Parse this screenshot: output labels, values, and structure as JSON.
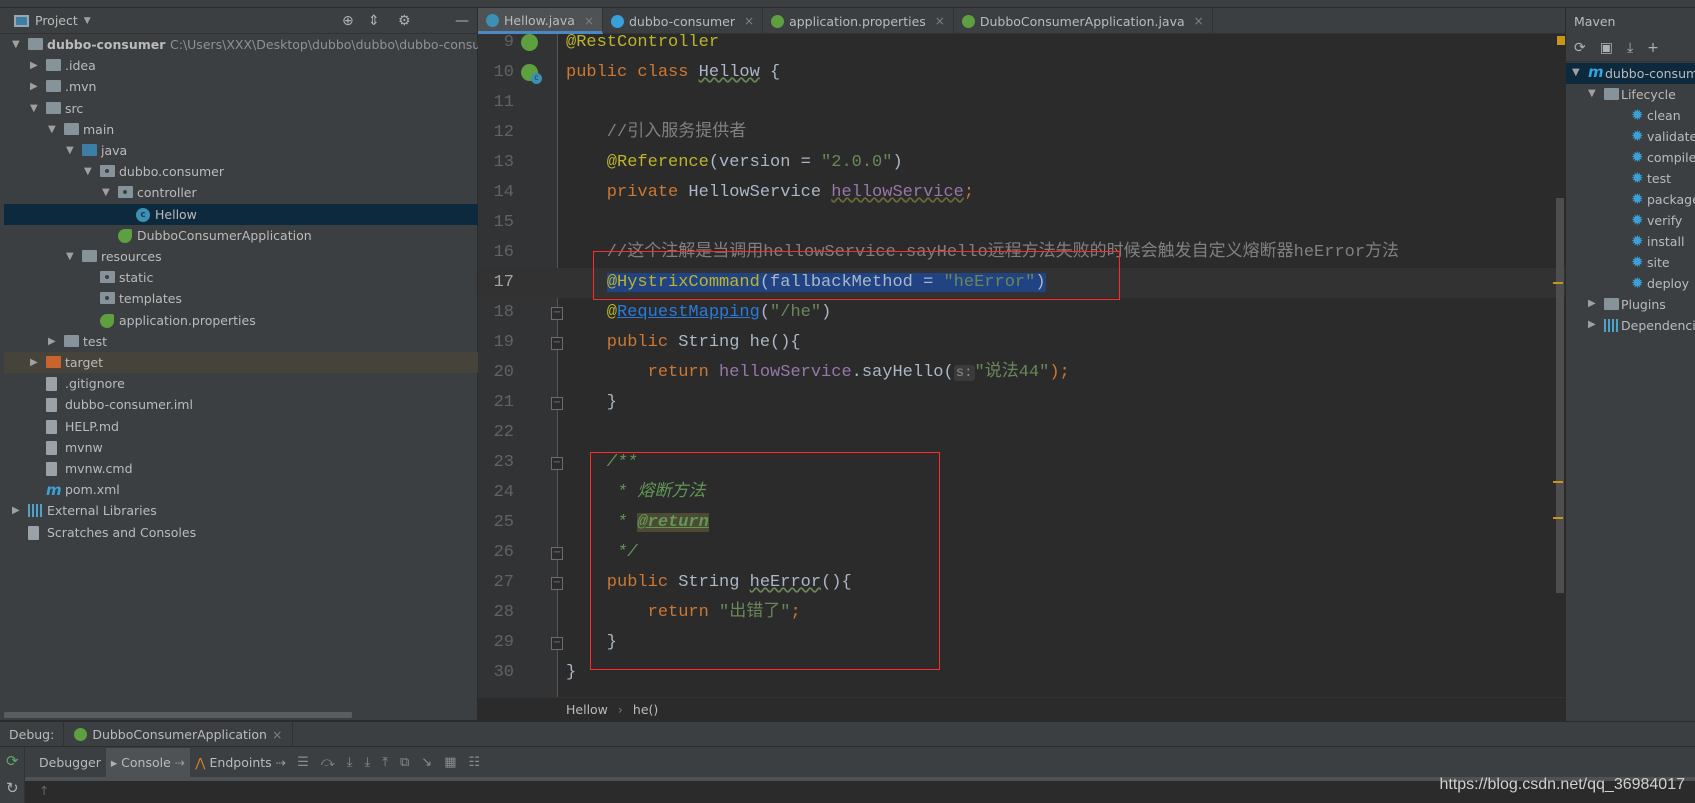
{
  "project_panel": {
    "title": "Project",
    "tree": [
      {
        "label": "dubbo-consumer",
        "path": "C:\\Users\\XXX\\Desktop\\dubbo\\dubbo\\dubbo-consumer",
        "depth": 0,
        "arrow": "down",
        "icon": "module-folder"
      },
      {
        "label": ".idea",
        "depth": 1,
        "arrow": "right",
        "icon": "folder"
      },
      {
        "label": ".mvn",
        "depth": 1,
        "arrow": "right",
        "icon": "folder"
      },
      {
        "label": "src",
        "depth": 1,
        "arrow": "down",
        "icon": "folder"
      },
      {
        "label": "main",
        "depth": 2,
        "arrow": "down",
        "icon": "folder"
      },
      {
        "label": "java",
        "depth": 3,
        "arrow": "down",
        "icon": "source-folder"
      },
      {
        "label": "dubbo.consumer",
        "depth": 4,
        "arrow": "down",
        "icon": "package"
      },
      {
        "label": "controller",
        "depth": 5,
        "arrow": "down",
        "icon": "package"
      },
      {
        "label": "Hellow",
        "depth": 6,
        "arrow": "",
        "icon": "class",
        "selected": true
      },
      {
        "label": "DubboConsumerApplication",
        "depth": 5,
        "arrow": "",
        "icon": "spring-boot"
      },
      {
        "label": "resources",
        "depth": 3,
        "arrow": "down",
        "icon": "resources-folder"
      },
      {
        "label": "static",
        "depth": 4,
        "arrow": "",
        "icon": "package"
      },
      {
        "label": "templates",
        "depth": 4,
        "arrow": "",
        "icon": "package"
      },
      {
        "label": "application.properties",
        "depth": 4,
        "arrow": "",
        "icon": "spring-properties"
      },
      {
        "label": "test",
        "depth": 2,
        "arrow": "right",
        "icon": "folder"
      },
      {
        "label": "target",
        "depth": 1,
        "arrow": "right",
        "icon": "excluded-folder",
        "highlighted": true
      },
      {
        "label": ".gitignore",
        "depth": 1,
        "arrow": "",
        "icon": "file"
      },
      {
        "label": "dubbo-consumer.iml",
        "depth": 1,
        "arrow": "",
        "icon": "file"
      },
      {
        "label": "HELP.md",
        "depth": 1,
        "arrow": "",
        "icon": "markdown"
      },
      {
        "label": "mvnw",
        "depth": 1,
        "arrow": "",
        "icon": "file"
      },
      {
        "label": "mvnw.cmd",
        "depth": 1,
        "arrow": "",
        "icon": "file"
      },
      {
        "label": "pom.xml",
        "depth": 1,
        "arrow": "",
        "icon": "maven"
      },
      {
        "label": "External Libraries",
        "depth": 0,
        "arrow": "right",
        "icon": "libraries"
      },
      {
        "label": "Scratches and Consoles",
        "depth": 0,
        "arrow": "",
        "icon": "scratches"
      }
    ]
  },
  "tabs": [
    {
      "label": "Hellow.java",
      "icon": "class",
      "active": true
    },
    {
      "label": "dubbo-consumer",
      "icon": "maven"
    },
    {
      "label": "application.properties",
      "icon": "spring-properties"
    },
    {
      "label": "DubboConsumerApplication.java",
      "icon": "spring-boot"
    }
  ],
  "editor": {
    "lines": [
      {
        "n": "9",
        "gutter": "bean",
        "tokens": [
          {
            "t": "@RestController",
            "k": "ann"
          }
        ]
      },
      {
        "n": "10",
        "gutter": "bean-class",
        "tokens": [
          {
            "t": "public class ",
            "k": "kw"
          },
          {
            "t": "Hellow",
            "k": "txt warn"
          },
          {
            "t": " {",
            "k": "txt"
          }
        ]
      },
      {
        "n": "11",
        "tokens": []
      },
      {
        "n": "12",
        "tokens": [
          {
            "t": "    //引入服务提供者",
            "k": "cmt"
          }
        ]
      },
      {
        "n": "13",
        "tokens": [
          {
            "t": "    @Reference",
            "k": "ann"
          },
          {
            "t": "(version = ",
            "k": "txt"
          },
          {
            "t": "\"2.0.0\"",
            "k": "str"
          },
          {
            "t": ")",
            "k": "txt"
          }
        ]
      },
      {
        "n": "14",
        "tokens": [
          {
            "t": "    private ",
            "k": "kw"
          },
          {
            "t": "HellowService ",
            "k": "txt"
          },
          {
            "t": "hellowService",
            "k": "fld"
          },
          {
            "t": ";",
            "k": "kw"
          }
        ]
      },
      {
        "n": "15",
        "tokens": []
      },
      {
        "n": "16",
        "tokens": [
          {
            "t": "    //这个注解是当调用hellowService.sayHello远程方法失败的时候会触发自定义熔断器heError方法",
            "k": "cmt"
          }
        ]
      },
      {
        "n": "17",
        "current": true,
        "fold": "-",
        "tokens": [
          {
            "t": "    ",
            "k": "txt"
          },
          {
            "t": "@HystrixCommand",
            "k": "ann sel"
          },
          {
            "t": "(fallbackMethod = ",
            "k": "txt sel"
          },
          {
            "t": "\"heError\"",
            "k": "str sel"
          },
          {
            "t": ")",
            "k": "txt sel"
          }
        ]
      },
      {
        "n": "18",
        "fold": "-",
        "tokens": [
          {
            "t": "    @",
            "k": "ann"
          },
          {
            "t": "RequestMapping",
            "k": "link"
          },
          {
            "t": "(",
            "k": "txt"
          },
          {
            "t": "\"/he\"",
            "k": "str"
          },
          {
            "t": ")",
            "k": "txt"
          }
        ]
      },
      {
        "n": "19",
        "fold": "-",
        "tokens": [
          {
            "t": "    public ",
            "k": "kw"
          },
          {
            "t": "String he(){",
            "k": "txt"
          }
        ]
      },
      {
        "n": "20",
        "tokens": [
          {
            "t": "        return ",
            "k": "kw"
          },
          {
            "t": "hellowService",
            "k": "fld2"
          },
          {
            "t": ".sayHello(",
            "k": "txt"
          },
          {
            "t": "s:",
            "k": "hint"
          },
          {
            "t": "\"说法44\"",
            "k": "str"
          },
          {
            "t": ");",
            "k": "kw"
          }
        ]
      },
      {
        "n": "21",
        "fold": "-",
        "tokens": [
          {
            "t": "    }",
            "k": "txt"
          }
        ]
      },
      {
        "n": "22",
        "tokens": []
      },
      {
        "n": "23",
        "fold": "-",
        "tokens": [
          {
            "t": "    /**",
            "k": "doc"
          }
        ]
      },
      {
        "n": "24",
        "tokens": [
          {
            "t": "     * 熔断方法",
            "k": "doc"
          }
        ]
      },
      {
        "n": "25",
        "tokens": [
          {
            "t": "     * ",
            "k": "doc"
          },
          {
            "t": "@return",
            "k": "docTag"
          }
        ]
      },
      {
        "n": "26",
        "fold": "-",
        "tokens": [
          {
            "t": "     */",
            "k": "doc"
          }
        ]
      },
      {
        "n": "27",
        "fold": "-",
        "tokens": [
          {
            "t": "    public ",
            "k": "kw"
          },
          {
            "t": "String ",
            "k": "txt"
          },
          {
            "t": "heError",
            "k": "txt warn"
          },
          {
            "t": "(){",
            "k": "txt"
          }
        ]
      },
      {
        "n": "28",
        "tokens": [
          {
            "t": "        return ",
            "k": "kw"
          },
          {
            "t": "\"出错了\"",
            "k": "str"
          },
          {
            "t": ";",
            "k": "kw"
          }
        ]
      },
      {
        "n": "29",
        "fold": "-",
        "tokens": [
          {
            "t": "    }",
            "k": "txt"
          }
        ]
      },
      {
        "n": "30",
        "tokens": [
          {
            "t": "}",
            "k": "txt"
          }
        ]
      }
    ],
    "breadcrumb": [
      "Hellow",
      "he()"
    ]
  },
  "maven": {
    "title": "Maven",
    "root": "dubbo-consumer",
    "lifecycle": "Lifecycle",
    "phases": [
      "clean",
      "validate",
      "compile",
      "test",
      "package",
      "verify",
      "install",
      "site",
      "deploy"
    ],
    "plugins": "Plugins",
    "dependencies": "Dependencies"
  },
  "debug": {
    "label": "Debug:",
    "config": "DubboConsumerApplication",
    "tabs": [
      {
        "label": "Debugger"
      },
      {
        "label": "Console",
        "active": true
      },
      {
        "label": "Endpoints"
      }
    ]
  },
  "watermark": "https://blog.csdn.net/qq_36984017",
  "colors": {
    "accent": "#4a88c7",
    "highlight_box": "#ff2a2a",
    "selection": "#214283"
  }
}
